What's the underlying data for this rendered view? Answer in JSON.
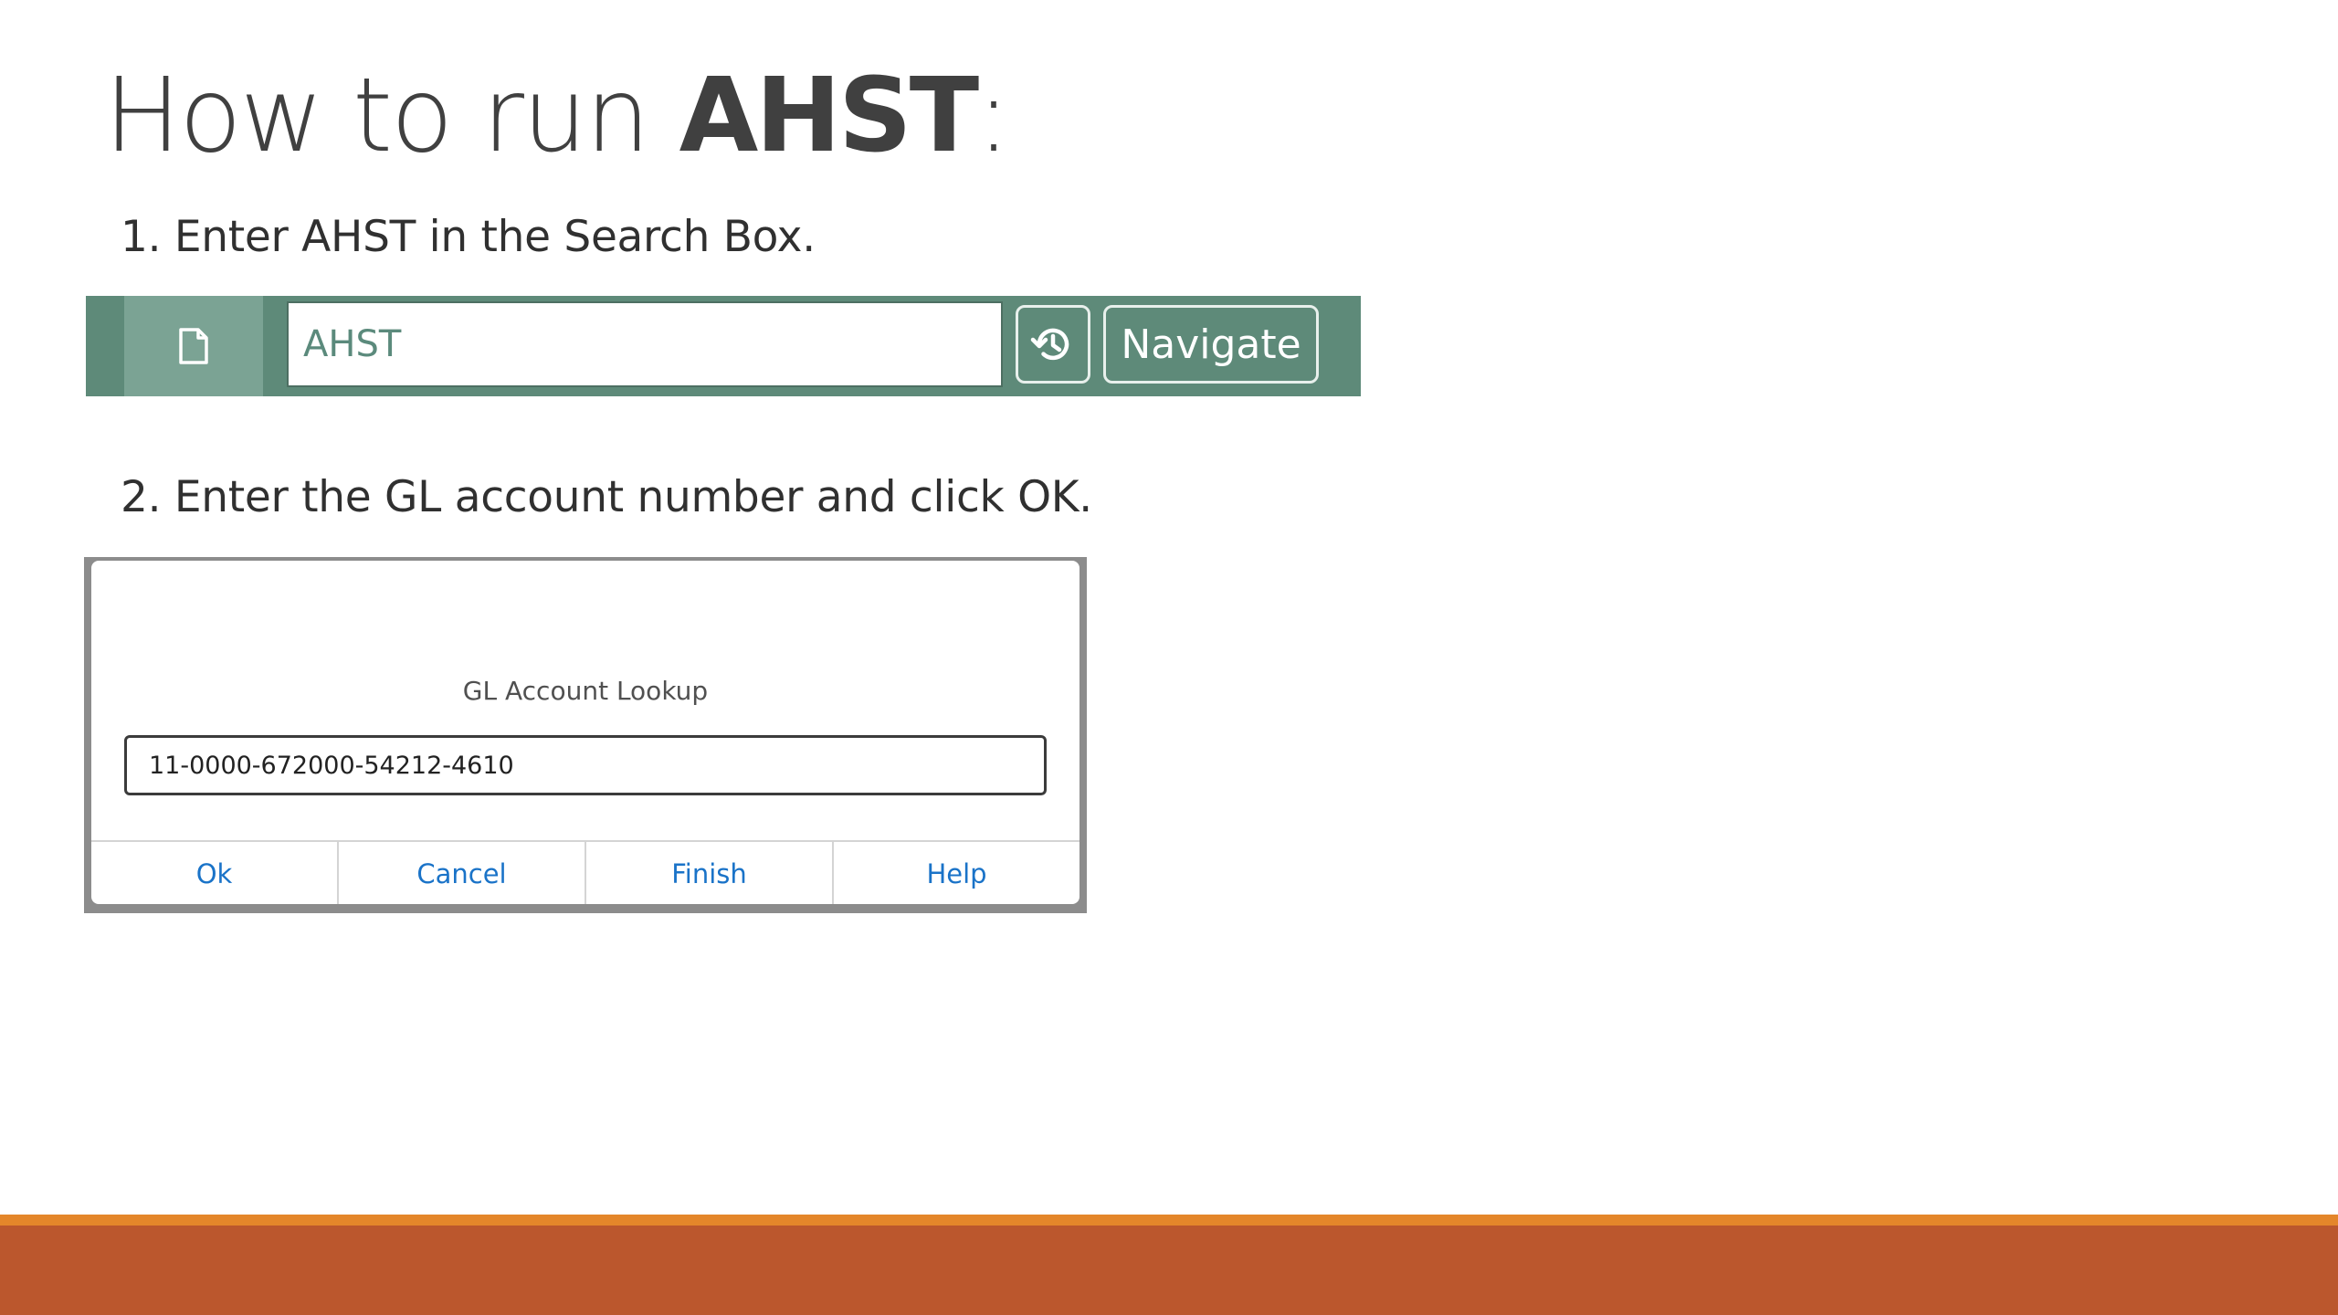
{
  "slide": {
    "title_prefix": "How to run ",
    "title_bold": "AHST",
    "title_suffix": ":",
    "step1": "1. Enter AHST in the Search Box.",
    "step2": "2. Enter the GL account number and click OK."
  },
  "searchbar": {
    "value": "AHST",
    "navigate_label": "Navigate",
    "doc_icon": "document-icon",
    "history_icon": "history-icon"
  },
  "dialog": {
    "title": "GL Account Lookup",
    "account_value": "11-0000-672000-54212-4610",
    "buttons": [
      "Ok",
      "Cancel",
      "Finish",
      "Help"
    ]
  },
  "colors": {
    "bar_green": "#5e8a79",
    "footer_orange": "#e4862a",
    "footer_rust": "#bb572d",
    "link_blue": "#1a73c8"
  }
}
